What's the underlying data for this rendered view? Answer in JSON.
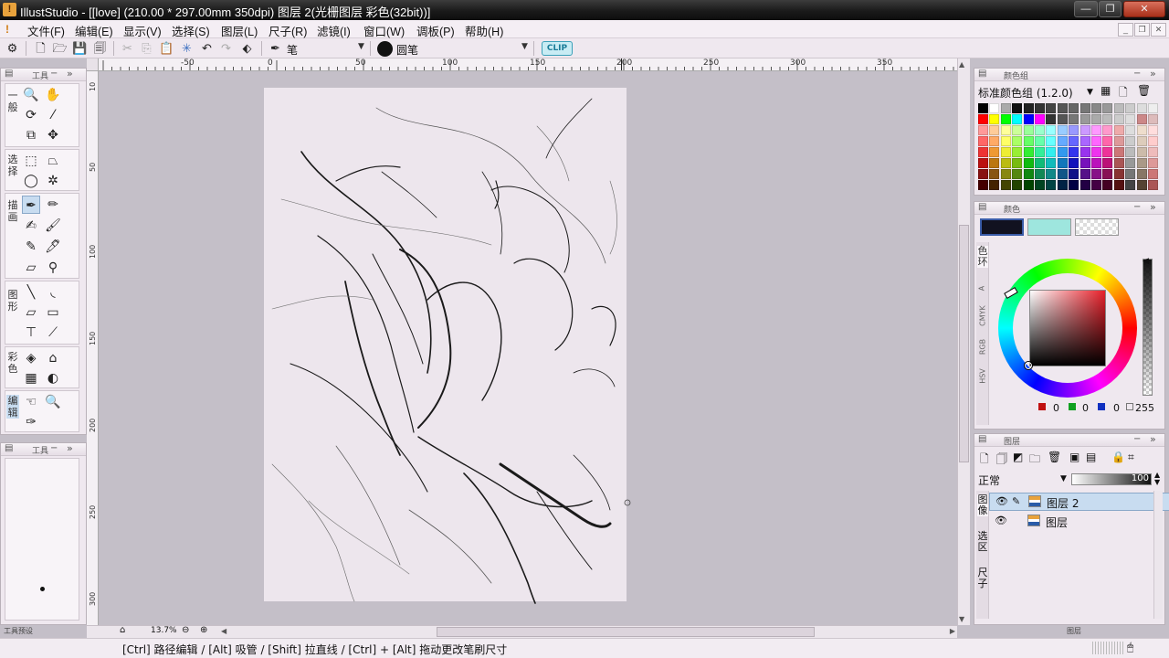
{
  "window": {
    "title": "IllustStudio - [[love] (210.00 * 297.00mm 350dpi)   图层 2(光栅图层 彩色(32bit))]",
    "minimize": "—",
    "restore": "❐",
    "close": "✕"
  },
  "menu": {
    "items": [
      "文件(F)",
      "编辑(E)",
      "显示(V)",
      "选择(S)",
      "图层(L)",
      "尺子(R)",
      "滤镜(I)",
      "窗口(W)",
      "调板(P)",
      "帮助(H)"
    ]
  },
  "toolbar": {
    "tool_name": "笔",
    "brush_name": "圆笔",
    "clip_label": "CLIP"
  },
  "ruler": {
    "h_ticks": [
      "-50",
      "0",
      "50",
      "100",
      "150",
      "200",
      "250",
      "300",
      "350"
    ],
    "v_ticks": [
      "10",
      "50",
      "100",
      "150",
      "200",
      "250",
      "300"
    ]
  },
  "tool_panel": {
    "title": "工具",
    "groups": [
      {
        "label": "一般"
      },
      {
        "label": "选择"
      },
      {
        "label": "描画"
      },
      {
        "label": "图形"
      },
      {
        "label": "彩色"
      },
      {
        "label": "编辑"
      }
    ]
  },
  "tool_option_panel": {
    "title": "工具"
  },
  "status": {
    "zoom": "13.7%",
    "preset_label": "工具预设",
    "hint": "[Ctrl] 路径编辑 / [Alt] 吸管 / [Shift] 拉直线 / [Ctrl] + [Alt] 拖动更改笔刷尺寸",
    "layer_label": "图层"
  },
  "color_set_panel": {
    "title": "颜色组",
    "set_name": "标准颜色组 (1.2.0)"
  },
  "color_panel": {
    "title": "颜色",
    "main_color": "#111220",
    "sub_color": "#9ee6de",
    "tabs": [
      "色环",
      "A",
      "CMYK",
      "RGB",
      "HSV"
    ],
    "r": "0",
    "g": "0",
    "b": "0",
    "alpha": "255"
  },
  "layer_panel": {
    "title": "图层",
    "blend_mode": "正常",
    "opacity": "100",
    "side_tabs": [
      "图像",
      "选区",
      "尺子"
    ],
    "layers": [
      {
        "name": "图层 2",
        "selected": true
      },
      {
        "name": "图层",
        "selected": false
      }
    ]
  },
  "colors": {
    "accent": "#8aa8c8",
    "paper": "#ede6ed",
    "titlebar": "#1a1a1a"
  }
}
